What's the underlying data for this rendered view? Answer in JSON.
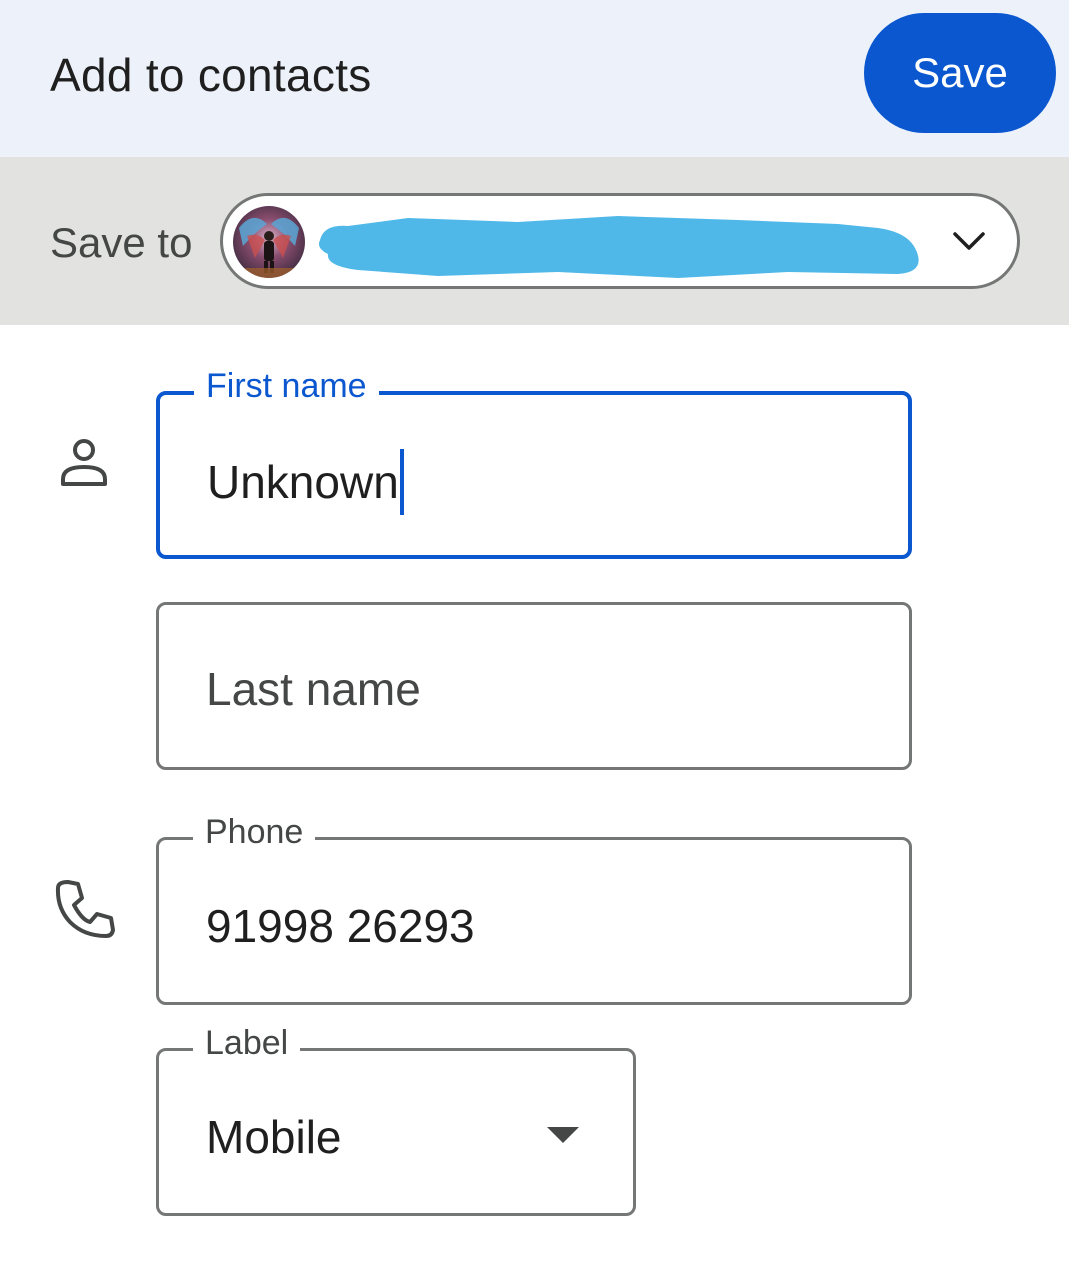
{
  "header": {
    "title": "Add to contacts",
    "save_label": "Save"
  },
  "save_to": {
    "label": "Save to",
    "account_icon": "chevron-down-icon"
  },
  "form": {
    "first_name": {
      "label": "First name",
      "value": "Unknown"
    },
    "last_name": {
      "placeholder": "Last name",
      "value": ""
    },
    "phone": {
      "label": "Phone",
      "value": "91998 26293"
    },
    "phone_label": {
      "label": "Label",
      "selected": "Mobile"
    }
  },
  "colors": {
    "accent": "#0b57d0",
    "header_bg": "#edf2fa",
    "saveto_bg": "#e2e3e0",
    "redaction": "#4fb8e8"
  }
}
